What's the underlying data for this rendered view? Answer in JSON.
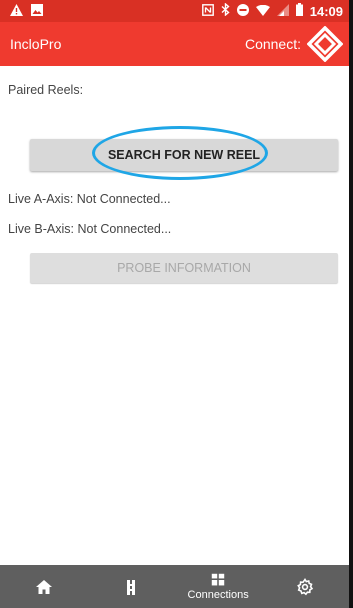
{
  "status_bar": {
    "time": "14:09",
    "left_icons": [
      "warning-icon",
      "image-icon"
    ],
    "right_icons": [
      "nfc-icon",
      "bluetooth-icon",
      "do-not-disturb-icon",
      "wifi-icon",
      "signal-icon",
      "battery-icon"
    ]
  },
  "app_bar": {
    "title": "IncloPro",
    "connect_label": "Connect:"
  },
  "content": {
    "paired_reels_label": "Paired Reels:",
    "search_button_label": "SEARCH FOR NEW REEL",
    "live_a_axis": "Live A-Axis: Not Connected...",
    "live_b_axis": "Live B-Axis: Not Connected...",
    "probe_button_label": "PROBE INFORMATION"
  },
  "bottom_nav": {
    "items": [
      {
        "icon": "home-icon",
        "label": ""
      },
      {
        "icon": "reel-icon",
        "label": ""
      },
      {
        "icon": "connections-icon",
        "label": "Connections"
      },
      {
        "icon": "settings-icon",
        "label": ""
      }
    ]
  },
  "colors": {
    "status_bar": "#d93024",
    "app_bar": "#ef3a2f",
    "highlight": "#1fa6e6",
    "bottom_nav": "#5f5f5f"
  }
}
